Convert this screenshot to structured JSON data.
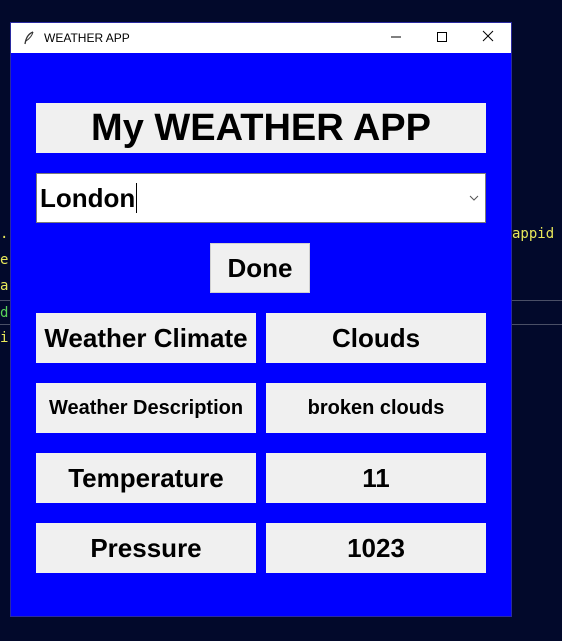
{
  "window": {
    "title": "WEATHER APP"
  },
  "terminal": {
    "right_text": "appid",
    "left_fragments": [
      ".",
      "e",
      "a",
      "d",
      "i"
    ]
  },
  "app": {
    "heading": "My WEATHER APP",
    "city_selected": "London",
    "done_label": "Done",
    "rows": [
      {
        "label": "Weather Climate",
        "value": "Clouds"
      },
      {
        "label": "Weather Description",
        "value": "broken clouds"
      },
      {
        "label": "Temperature",
        "value": "11"
      },
      {
        "label": "Pressure",
        "value": "1023"
      }
    ]
  },
  "colors": {
    "window_bg": "#0000ff",
    "widget_bg": "#f0f0f0",
    "terminal_bg": "#02092b"
  },
  "icons": {
    "app_icon": "feather-icon",
    "minimize": "minimize-icon",
    "maximize": "maximize-icon",
    "close": "close-icon",
    "dropdown": "chevron-down-icon"
  }
}
